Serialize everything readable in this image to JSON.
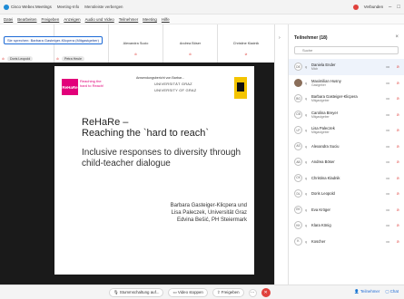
{
  "titlebar": {
    "app": "Cisco Webex Meetings",
    "meeting_info": "Meeting-Info",
    "hidden_meetings": "Menüleiste verbergen",
    "connection": "Verbunden",
    "colors": {
      "connected": "#e0413c",
      "logo": "#1d8bd6"
    }
  },
  "menubar": {
    "items": [
      "Datei",
      "Bearbeiten",
      "Freigeben",
      "Anzeigen",
      "Audio und Video",
      "Teilnehmer",
      "Meeting",
      "Hilfe"
    ]
  },
  "gallery": {
    "viewing_label": "Sie sprechen: Barbara Gasteiger-Klicpera (Mitgastgeber)",
    "thumbs": [
      {
        "name": "",
        "status": ""
      },
      {
        "name": "",
        "status": ""
      },
      {
        "name": "Alexandra Sucio",
        "status": ""
      },
      {
        "name": "Andrea Böser",
        "status": ""
      },
      {
        "name": "Christine Kladnik",
        "status": ""
      }
    ],
    "speaker_left": "Doris Leopold",
    "speaker_mid": "Petra Heule"
  },
  "slide": {
    "caption": "Anwendungsbericht von Barbar...",
    "uni_line1": "UNIVERSITÄT GRAZ",
    "uni_line2": "UNIVERSITY OF GRAZ",
    "logo_re": "ReHaRe",
    "logo_text": "Reaching the hard to Reach!",
    "title": "ReHaRe –",
    "subtitle": "Reaching the `hard to reach`",
    "body": "Inclusive responses to diversity through child-teacher dialogue",
    "authors_line1": "Barbara Gasteiger-Klicpera und",
    "authors_line2": "Lisa Paleczek, Universität Graz",
    "authors_line3": "Edvina Bešić, PH Steiermark"
  },
  "controls": {
    "mute": "Stummschaltung auf...",
    "video": "Video stoppen",
    "share": "Freigeben",
    "more": "···",
    "leave": "✕",
    "participants": "Teilnehmer",
    "chat": "Chat"
  },
  "panel": {
    "title": "Teilnehmer (18)",
    "search_placeholder": "Suche",
    "participants": [
      {
        "initials": "DE",
        "name": "Daniela Ender",
        "role": "Mich",
        "selected": true,
        "photo": false
      },
      {
        "initials": "MH",
        "name": "Maximilian Husny",
        "role": "Gastgeber",
        "selected": false,
        "photo": true
      },
      {
        "initials": "BG",
        "name": "Barbara Gasteiger-Klicpera",
        "role": "Mitgastgeber",
        "selected": false,
        "photo": false
      },
      {
        "initials": "CB",
        "name": "Carolina Breyer",
        "role": "Mitgastgeber",
        "selected": false,
        "photo": false
      },
      {
        "initials": "LP",
        "name": "Lisa Paleczek",
        "role": "Mitgastgeber",
        "selected": false,
        "photo": false
      },
      {
        "initials": "AS",
        "name": "Alexandra Suciu",
        "role": "",
        "selected": false,
        "photo": false
      },
      {
        "initials": "AB",
        "name": "Andrea Böser",
        "role": "",
        "selected": false,
        "photo": false
      },
      {
        "initials": "CK",
        "name": "Christina Kladnik",
        "role": "",
        "selected": false,
        "photo": false
      },
      {
        "initials": "DL",
        "name": "Doris Leopold",
        "role": "",
        "selected": false,
        "photo": false
      },
      {
        "initials": "EK",
        "name": "Eva Kröger",
        "role": "",
        "selected": false,
        "photo": false
      },
      {
        "initials": "KK",
        "name": "Klara König",
        "role": "",
        "selected": false,
        "photo": false
      },
      {
        "initials": "K",
        "name": "Koscher",
        "role": "",
        "selected": false,
        "photo": false
      }
    ]
  }
}
